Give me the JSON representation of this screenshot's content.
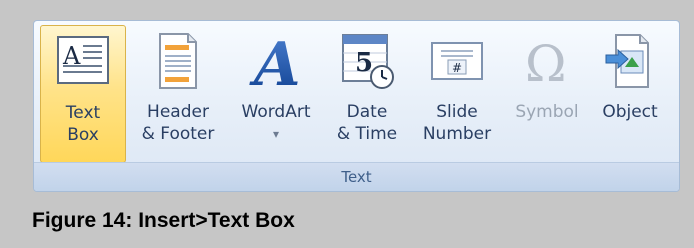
{
  "ribbon": {
    "group_label": "Text",
    "buttons": [
      {
        "id": "text-box",
        "line1": "Text",
        "line2": "Box"
      },
      {
        "id": "header-footer",
        "line1": "Header",
        "line2": "& Footer"
      },
      {
        "id": "wordart",
        "line1": "WordArt",
        "line2": "▾"
      },
      {
        "id": "date-time",
        "line1": "Date",
        "line2": "& Time"
      },
      {
        "id": "slide-number",
        "line1": "Slide",
        "line2": "Number"
      },
      {
        "id": "symbol",
        "line1": "Symbol",
        "line2": ""
      },
      {
        "id": "object",
        "line1": "Object",
        "line2": ""
      }
    ],
    "icon_glyphs": {
      "text_box": "A",
      "wordart": "A",
      "date": "5",
      "slide_number": "#",
      "symbol": "Ω"
    }
  },
  "caption": "Figure 14: Insert>Text Box",
  "colors": {
    "selected_bg": "#ffd75a",
    "label_text": "#2a3f63",
    "disabled_text": "#9aa5b3",
    "group_label": "#3f5f8a"
  }
}
